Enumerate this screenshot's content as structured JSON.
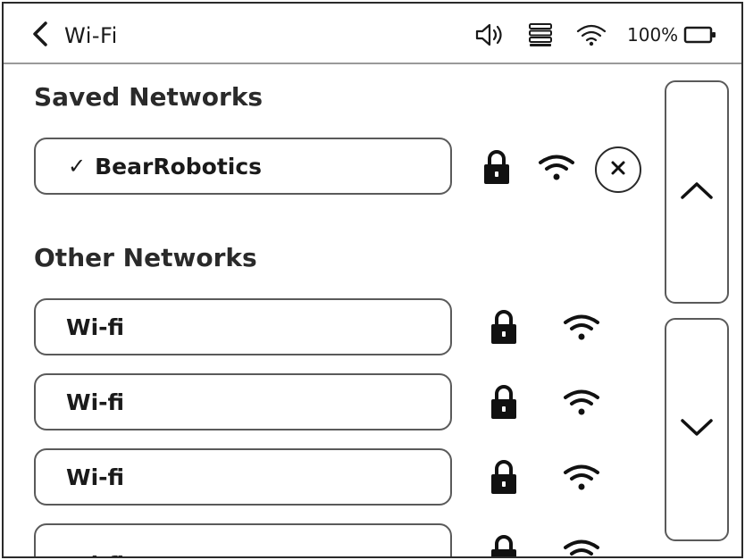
{
  "header": {
    "title": "Wi-Fi",
    "back_icon": "chevron-left-icon",
    "status": {
      "volume_icon": "speaker-icon",
      "storage_icon": "stack-icon",
      "wifi_icon": "wifi-icon",
      "battery_percent": "100%",
      "battery_icon": "battery-icon"
    }
  },
  "saved": {
    "title": "Saved Networks",
    "network": {
      "name": "BearRobotics",
      "check": "✓",
      "connected": true,
      "secured": true
    }
  },
  "other": {
    "title": "Other Networks",
    "networks": [
      {
        "name": "Wi-fi",
        "secured": true
      },
      {
        "name": "Wi-fi",
        "secured": true
      },
      {
        "name": "Wi-fi",
        "secured": true
      },
      {
        "name": "Wi-fi",
        "secured": true
      }
    ]
  },
  "scroll": {
    "up_icon": "chevron-up-icon",
    "down_icon": "chevron-down-icon"
  },
  "colors": {
    "border": "#5a5a5a",
    "text": "#1a1a1a",
    "divider": "#9a9a9a"
  }
}
